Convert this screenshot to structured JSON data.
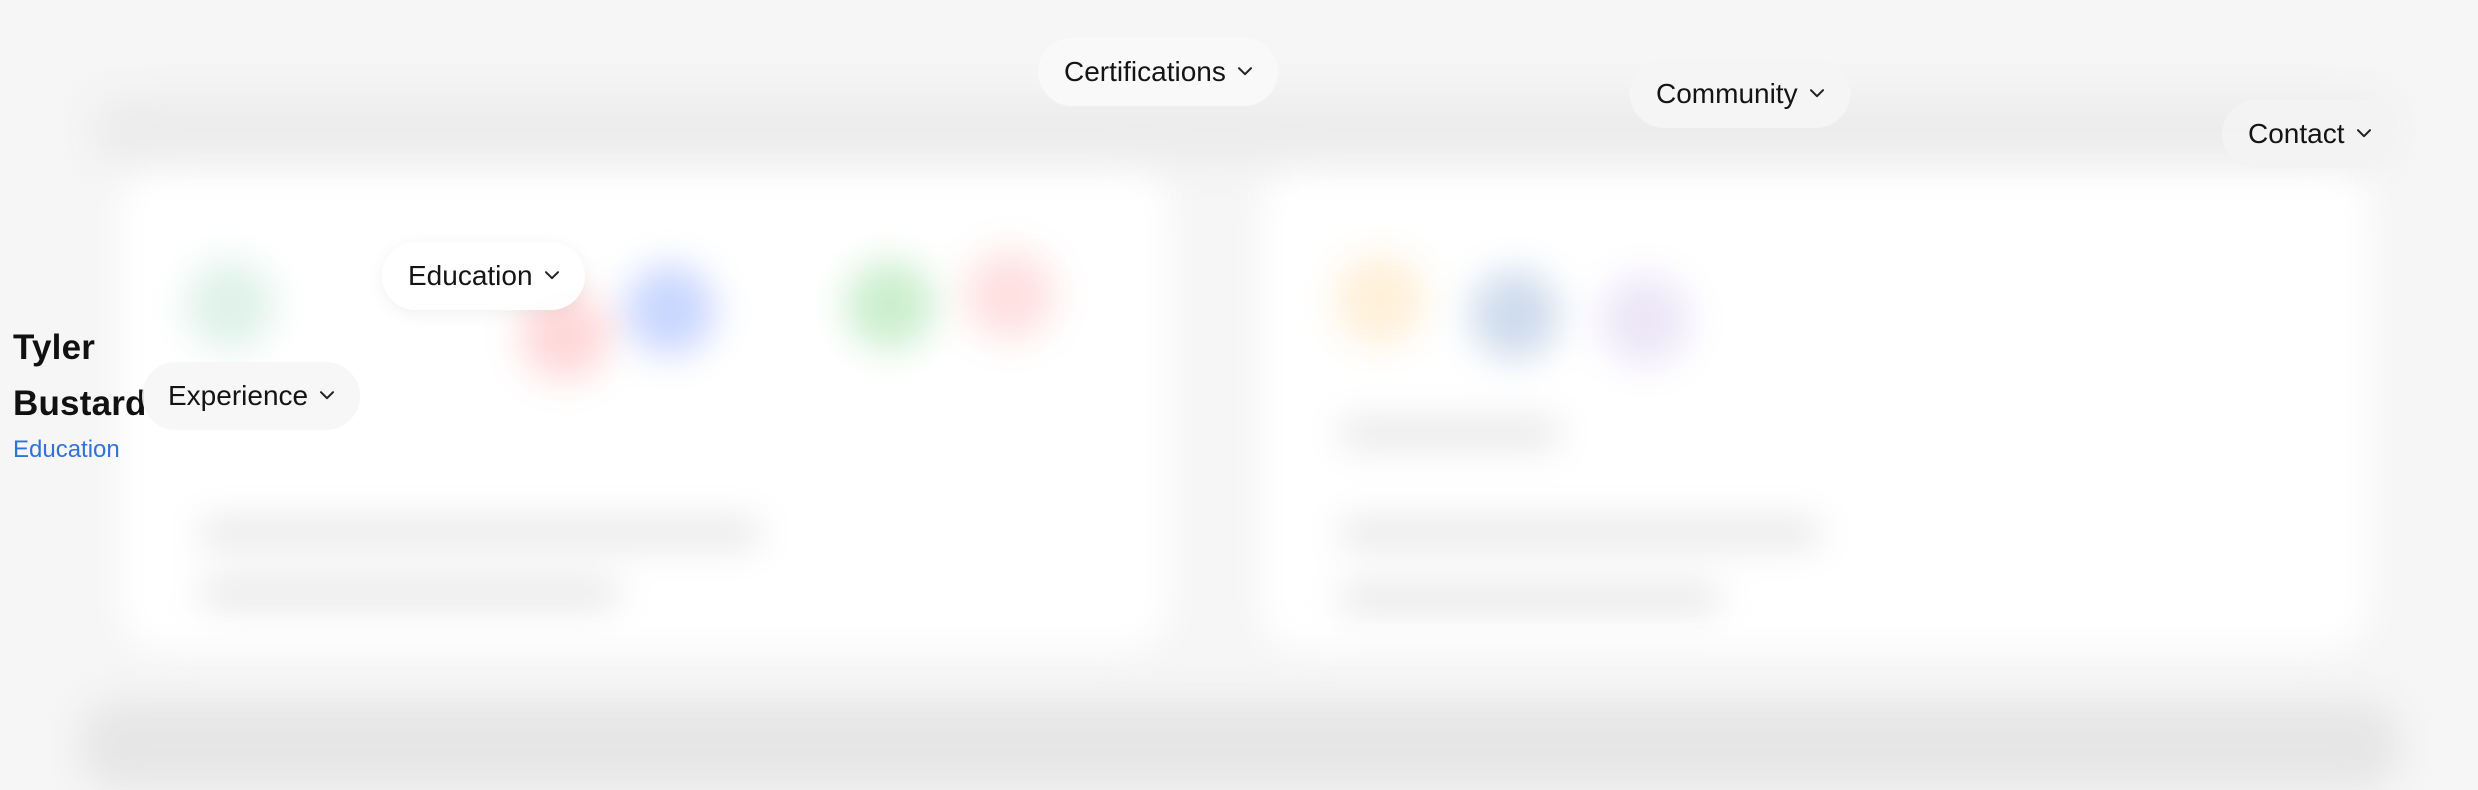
{
  "person": {
    "name": "Tyler Bustard",
    "section": "Education"
  },
  "nav": {
    "education": "Education",
    "experience": "Experience",
    "certifications": "Certifications",
    "community": "Community",
    "contact": "Contact"
  },
  "icons": {
    "dropdown": "chevron-down-icon"
  }
}
